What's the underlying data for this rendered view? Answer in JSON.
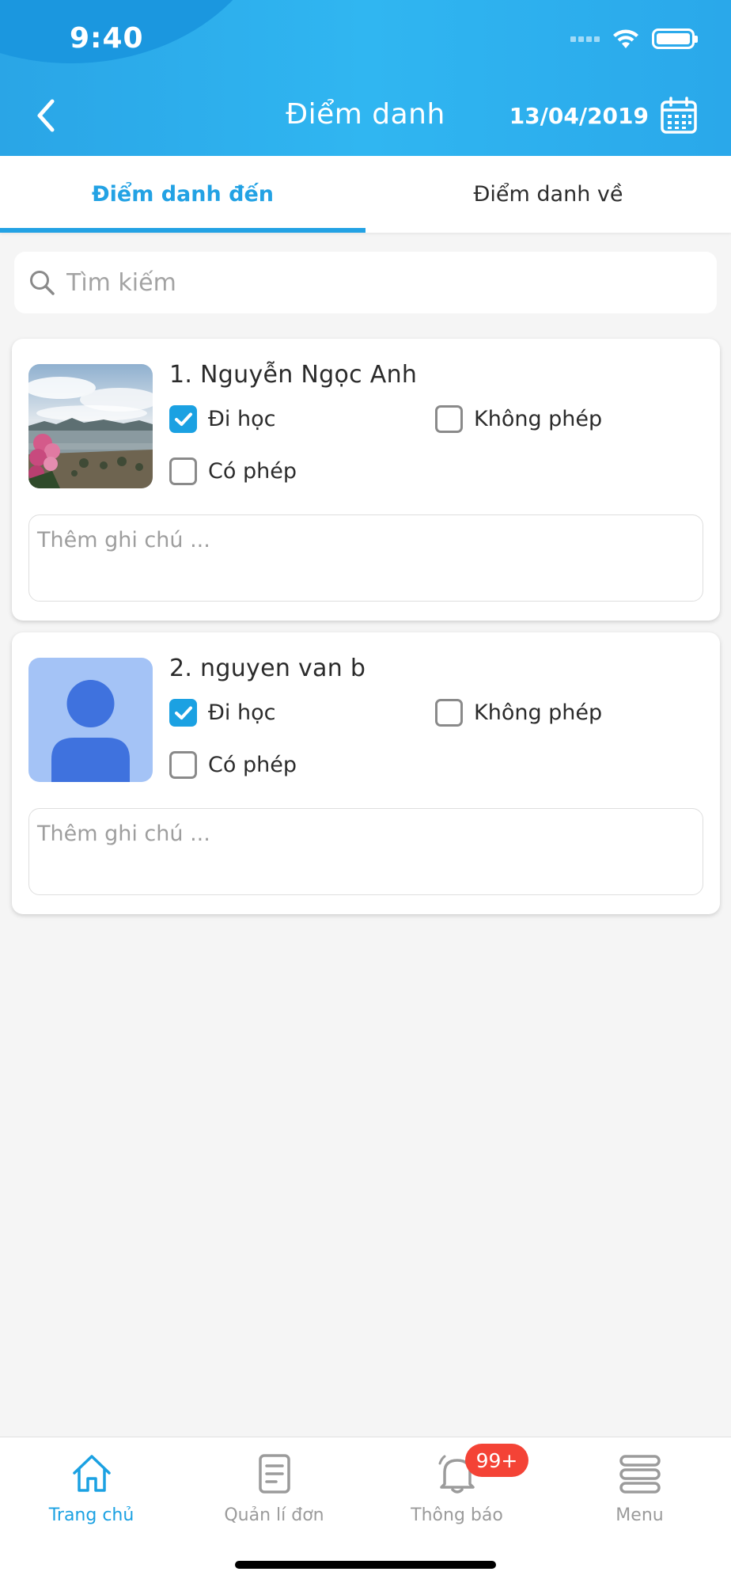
{
  "status_bar": {
    "time": "9:40"
  },
  "header": {
    "title": "Điểm danh",
    "date": "13/04/2019"
  },
  "tabs": [
    {
      "label": "Điểm danh đến",
      "active": true
    },
    {
      "label": "Điểm danh về",
      "active": false
    }
  ],
  "search": {
    "placeholder": "Tìm kiếm",
    "value": ""
  },
  "students": [
    {
      "name": "1. Nguyễn Ngọc Anh",
      "avatar": "landscape-photo",
      "options": [
        {
          "label": "Đi học",
          "checked": true
        },
        {
          "label": "Không phép",
          "checked": false
        },
        {
          "label": "Có phép",
          "checked": false
        }
      ],
      "note_placeholder": "Thêm ghi chú ..."
    },
    {
      "name": "2. nguyen van b",
      "avatar": "default-user",
      "options": [
        {
          "label": "Đi học",
          "checked": true
        },
        {
          "label": "Không phép",
          "checked": false
        },
        {
          "label": "Có phép",
          "checked": false
        }
      ],
      "note_placeholder": "Thêm ghi chú ..."
    }
  ],
  "bottom_nav": [
    {
      "label": "Trang chủ",
      "icon": "home-icon",
      "active": true
    },
    {
      "label": "Quản lí đơn",
      "icon": "document-icon",
      "active": false
    },
    {
      "label": "Thông báo",
      "icon": "bell-icon",
      "active": false,
      "badge": "99+"
    },
    {
      "label": "Menu",
      "icon": "menu-icon",
      "active": false
    }
  ],
  "colors": {
    "primary": "#1ba1e2",
    "header_gradient": "#30b6f1",
    "badge": "#f44336",
    "avatar_default_bg": "#a4c3f6",
    "avatar_default_fg": "#3f72de"
  }
}
